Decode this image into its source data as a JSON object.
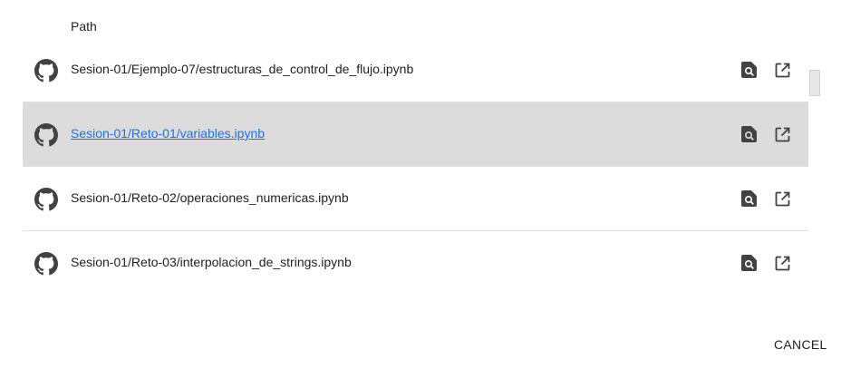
{
  "table": {
    "column_header": "Path",
    "rows": [
      {
        "path": "Sesion-01/Ejemplo-07/estructuras_de_control_de_flujo.ipynb",
        "selected": false
      },
      {
        "path": "Sesion-01/Reto-01/variables.ipynb",
        "selected": true
      },
      {
        "path": "Sesion-01/Reto-02/operaciones_numericas.ipynb",
        "selected": false
      },
      {
        "path": "Sesion-01/Reto-03/interpolacion_de_strings.ipynb",
        "selected": false
      }
    ]
  },
  "footer": {
    "cancel_label": "CANCEL"
  },
  "icons": {
    "row_icon": "github-icon",
    "preview": "preview-icon",
    "open": "open-in-new-tab-icon"
  },
  "colors": {
    "selected_row": "#dcdcdc",
    "link": "#1a73e8",
    "icon": "#424242"
  }
}
